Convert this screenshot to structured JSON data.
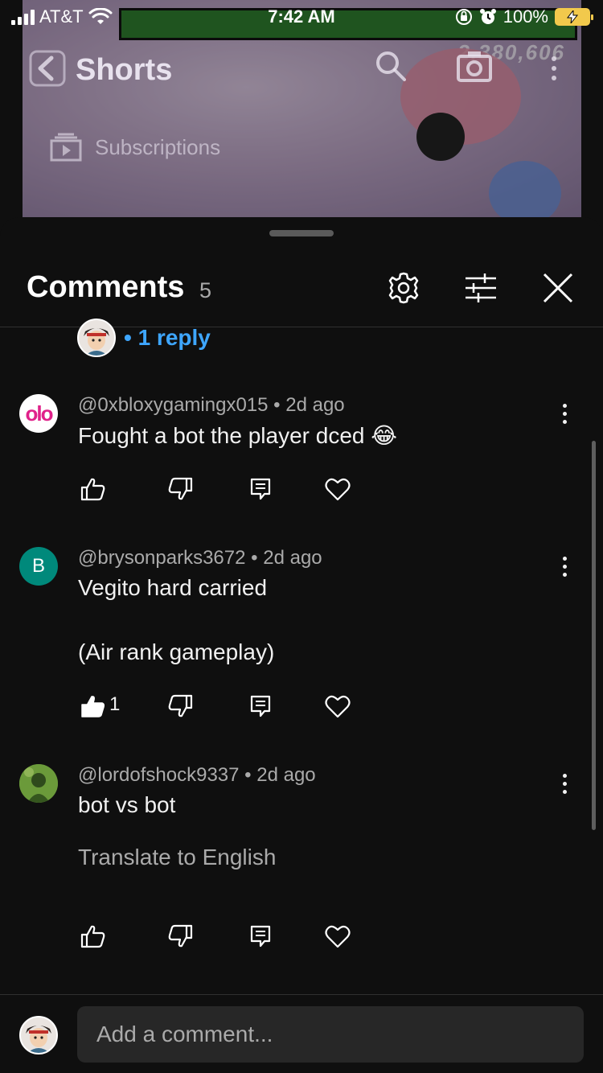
{
  "status_bar": {
    "carrier": "AT&T",
    "time": "7:42 AM",
    "battery": "100%"
  },
  "video": {
    "title": "Shorts",
    "subscriptions_label": "Subscriptions",
    "score": "2,380,606"
  },
  "comments_panel": {
    "title": "Comments",
    "count": "5",
    "reply_link": "• 1 reply",
    "comments": [
      {
        "avatar_text": "olo",
        "avatar_color": "#ffffff",
        "author": "@0xbloxygamingx015",
        "time": "2d ago",
        "lines": [
          "Fought a bot the player dced 😂"
        ],
        "likes": "",
        "liked": false
      },
      {
        "avatar_text": "B",
        "avatar_color": "#00897b",
        "author": "@brysonparks3672",
        "time": "2d ago",
        "lines": [
          "Vegito hard carried",
          "",
          "(Air rank gameplay)"
        ],
        "likes": "1",
        "liked": true
      },
      {
        "avatar_text": "",
        "avatar_color": "#4c7a2e",
        "author": "@lordofshock9337",
        "time": "2d ago",
        "lines": [
          "bot vs bot"
        ],
        "translate": "Translate to English",
        "likes": "",
        "liked": false
      }
    ]
  },
  "composer": {
    "placeholder": "Add a comment..."
  },
  "colors": {
    "background": "#0f0f0f",
    "link": "#3ea6ff",
    "secondary_text": "#aaaaaa",
    "battery": "#f2c94c"
  }
}
